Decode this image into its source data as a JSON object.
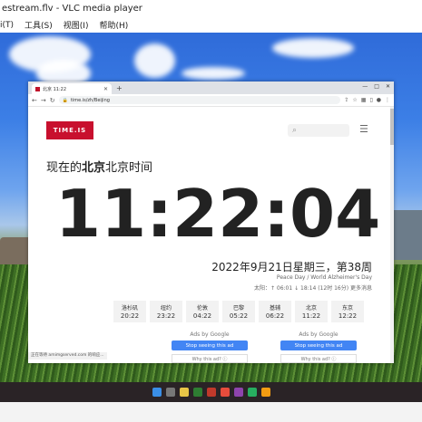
{
  "vlc": {
    "title": "estream.flv - VLC media player",
    "menu": [
      "i(T)",
      "工具(S)",
      "视图(I)",
      "帮助(H)"
    ]
  },
  "browser": {
    "tab_title": "北京 11:22",
    "url": "time.is/zh/Beijing",
    "new_tab": "+",
    "window_controls": [
      "—",
      "□",
      "✕"
    ]
  },
  "page": {
    "logo": "TIME.IS",
    "heading_prefix": "现在的",
    "heading_city": "北京",
    "heading_suffix": "北京时间",
    "clock": "11:22:04",
    "date": "2022年9月21日星期三，第38周",
    "observance": "Peace Day / World Alzheimer's Day",
    "sun": "太阳：↑ 06:01 ↓ 18:14 (12时 16分) 更多消息",
    "cities": [
      {
        "name": "洛杉矶",
        "time": "20:22"
      },
      {
        "name": "纽约",
        "time": "23:22"
      },
      {
        "name": "伦敦",
        "time": "04:22"
      },
      {
        "name": "巴黎",
        "time": "05:22"
      },
      {
        "name": "基辅",
        "time": "06:22"
      },
      {
        "name": "北京",
        "time": "11:22"
      },
      {
        "name": "东京",
        "time": "12:22"
      }
    ],
    "ads": [
      {
        "by": "Ads by Google",
        "stop": "Stop seeing this ad",
        "why": "Why this ad? ⓘ"
      },
      {
        "by": "Ads by Google",
        "stop": "Stop seeing this ad",
        "why": "Why this ad? ⓘ"
      }
    ],
    "status": "正在等待 amimgserved.com 的响应..."
  }
}
